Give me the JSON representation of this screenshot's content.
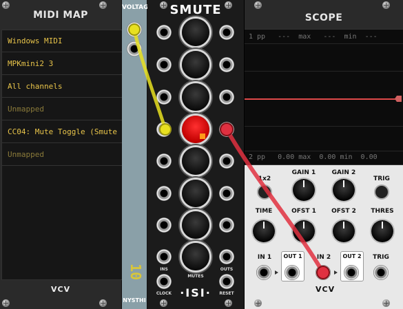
{
  "midimap": {
    "title": "MIDI MAP",
    "rows": [
      {
        "label": "Windows MIDI",
        "state": "on"
      },
      {
        "label": "MPKmini2 3",
        "state": "on"
      },
      {
        "label": "All channels",
        "state": "on"
      },
      {
        "label": "Unmapped",
        "state": "off"
      },
      {
        "label": "CC04: Mute Toggle (Smute",
        "state": "on"
      },
      {
        "label": "Unmapped",
        "state": "off"
      }
    ],
    "logo": "VCV"
  },
  "voltage": {
    "title": "VOLTAGE",
    "display": "10",
    "brand": "NYSTHI"
  },
  "smute": {
    "title": "SMUTE",
    "labels": {
      "ins": "INS",
      "mutes": "MUTES",
      "outs": "OUTS",
      "clock": "CLOCK",
      "reset": "RESET"
    },
    "brand": "·ISI·"
  },
  "scope": {
    "title": "SCOPE",
    "ch1": "1 pp   ---  max   ---  min  ---",
    "ch2": "2 pp   0.00 max  0.00 min  0.00",
    "controls": {
      "x1x2": "1x2",
      "gain1": "GAIN 1",
      "gain2": "GAIN 2",
      "trig": "TRIG",
      "time": "TIME",
      "ofst1": "OFST 1",
      "ofst2": "OFST 2",
      "thres": "THRES",
      "in1": "IN 1",
      "out1": "OUT 1",
      "in2": "IN 2",
      "out2": "OUT 2",
      "trig_in": "TRIG"
    },
    "logo": "VCV"
  },
  "colors": {
    "cable_yellow": "#e8e020",
    "cable_red": "#e03040",
    "trace": "#e04a4a",
    "midi_text_on": "#e8c44a",
    "midi_text_off": "#8a7a3a"
  }
}
